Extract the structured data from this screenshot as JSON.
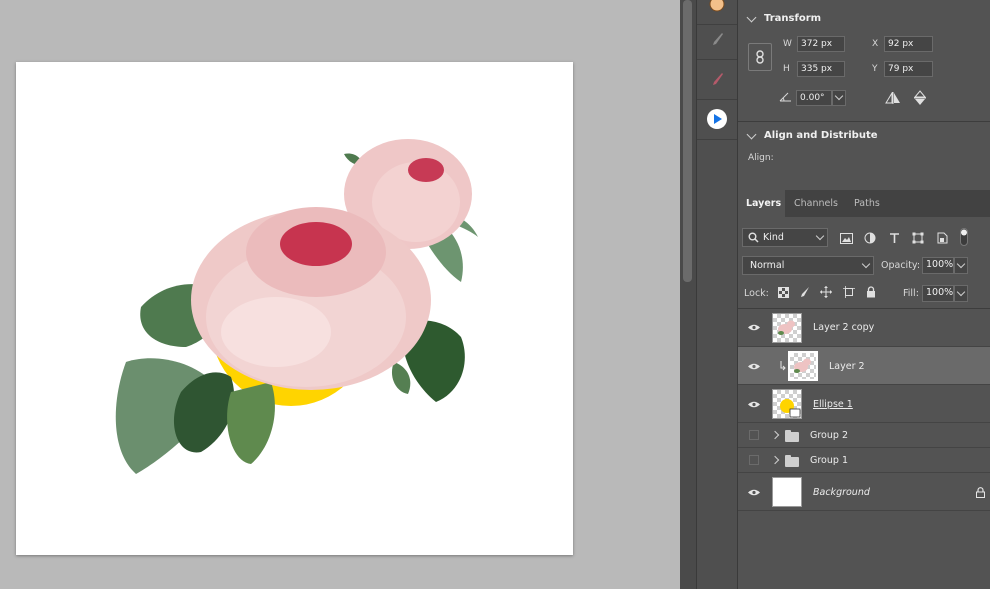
{
  "transform": {
    "title": "Transform",
    "w_label": "W",
    "w_value": "372 px",
    "h_label": "H",
    "h_value": "335 px",
    "x_label": "X",
    "x_value": "92 px",
    "y_label": "Y",
    "y_value": "79 px",
    "angle_value": "0.00°"
  },
  "align": {
    "title": "Align and Distribute",
    "align_label": "Align:"
  },
  "tabs": [
    "Layers",
    "Channels",
    "Paths"
  ],
  "layers_panel": {
    "filter_kind": "Kind",
    "blend_mode": "Normal",
    "opacity_label": "Opacity:",
    "opacity_value": "100%",
    "lock_label": "Lock:",
    "fill_label": "Fill:",
    "fill_value": "100%"
  },
  "layers": [
    {
      "name": "Layer 2 copy"
    },
    {
      "name": "Layer 2"
    },
    {
      "name": "Ellipse 1"
    },
    {
      "name": "Group 2"
    },
    {
      "name": "Group 1"
    },
    {
      "name": "Background"
    }
  ],
  "colors": {
    "canvas_bg": "#b9b9b9",
    "panel_bg": "#535353",
    "ellipse_yellow": "#ffd400",
    "accent_blue": "#1473e6"
  }
}
